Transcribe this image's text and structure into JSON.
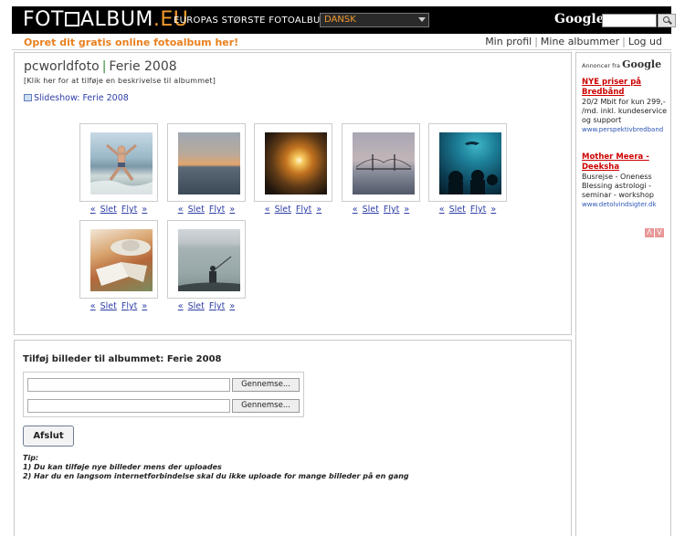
{
  "header": {
    "logo_left": "FOT",
    "logo_right": "ALBUM",
    "logo_tld": ".EU",
    "tagline": "EUROPAS STØRSTE FOTOALBUM",
    "language": "DANSK",
    "google_label": "Google:"
  },
  "subbar": {
    "create_link": "Opret dit gratis online fotoalbum her!",
    "my_profile": "Min profil",
    "my_albums": "Mine albummer",
    "logout": "Log ud",
    "sep": "|"
  },
  "album": {
    "user": "pcworldfoto",
    "pipe": "|",
    "name": "Ferie 2008",
    "description_link": "[Klik her for at tilføje en beskrivelse til albummet]",
    "slideshow": "Slideshow: Ferie 2008"
  },
  "thumb_actions": {
    "prev": "«",
    "delete": "Slet",
    "move": "Flyt",
    "next": "»"
  },
  "upload": {
    "title": "Tilføj billeder til albummet: Ferie 2008",
    "browse": "Gennemse...",
    "finish": "Afslut",
    "tip_title": "Tip:",
    "tip_1": "1) Du kan tilføje nye billeder mens der uploades",
    "tip_2": "2) Har du en langsom internetforbindelse skal du ikke uploade for mange billeder på en gang"
  },
  "ads": {
    "annoncer_fra": "Annoncer fra",
    "google": "Google",
    "items": [
      {
        "title": "NYE priser på Bredbånd",
        "body": "20/2 Mbit for kun 299,- /md. inkl. kundeservice og support",
        "url": "www.perspektivbredband"
      },
      {
        "title": "Mother Meera - Deeksha",
        "body": "Busrejse - Oneness Blessing astrologi - seminar - workshop",
        "url": "www.detolvindsigter.dk"
      }
    ],
    "nav_prev": "Λ",
    "nav_next": "V"
  },
  "colors": {
    "accent_orange": "#e8801e",
    "link_blue": "#2d3da6",
    "ad_red": "#cc0000",
    "title_pipe_green": "#3c8a3c"
  }
}
